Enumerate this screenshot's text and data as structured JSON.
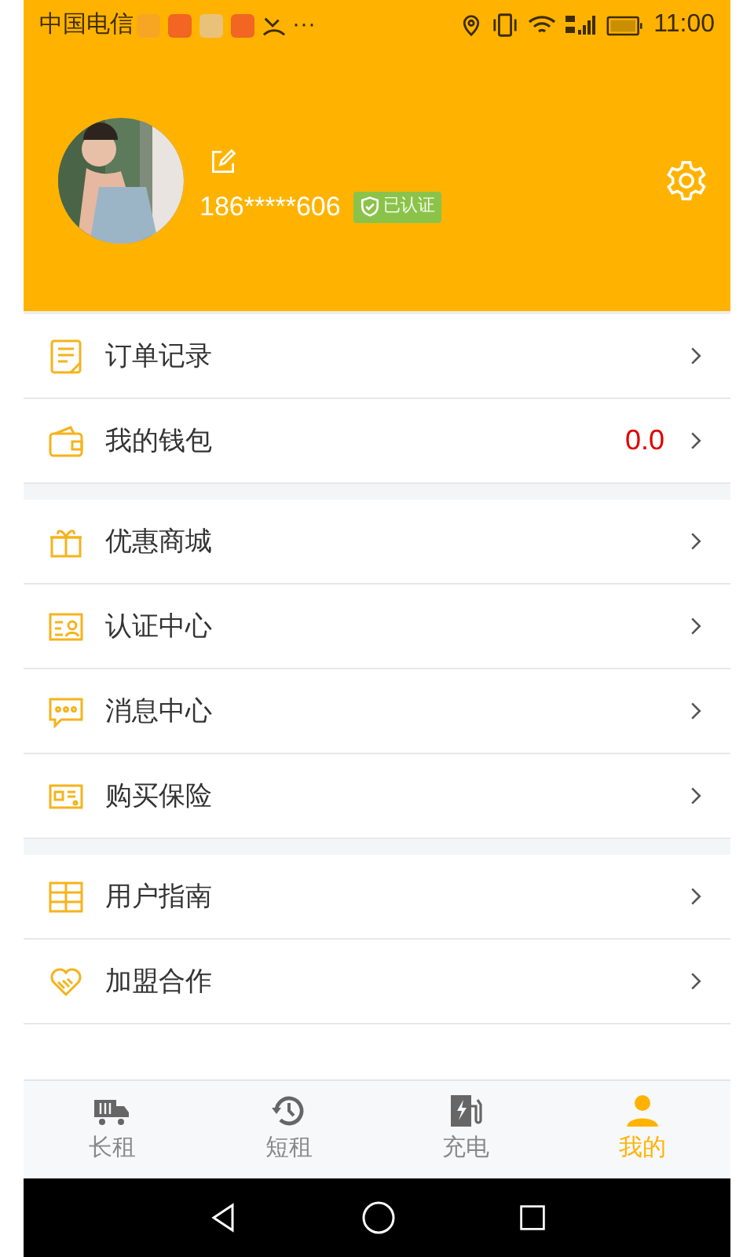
{
  "status_bar": {
    "carrier": "中国电信",
    "more": "···",
    "time": "11:00"
  },
  "profile": {
    "phone": "186*****606",
    "badge": "已认证"
  },
  "menu_groups": [
    [
      {
        "kind": "orders",
        "label": "订单记录"
      },
      {
        "kind": "wallet",
        "label": "我的钱包",
        "value": "0.0"
      }
    ],
    [
      {
        "kind": "gift",
        "label": "优惠商城"
      },
      {
        "kind": "idcard",
        "label": "认证中心"
      },
      {
        "kind": "message",
        "label": "消息中心"
      },
      {
        "kind": "ticket",
        "label": "购买保险"
      }
    ],
    [
      {
        "kind": "guide",
        "label": "用户指南"
      },
      {
        "kind": "handshake",
        "label": "加盟合作"
      }
    ]
  ],
  "tabs": [
    {
      "kind": "truck",
      "label": "长租",
      "selected": false
    },
    {
      "kind": "history",
      "label": "短租",
      "selected": false
    },
    {
      "kind": "charge",
      "label": "充电",
      "selected": false
    },
    {
      "kind": "person",
      "label": "我的",
      "selected": true
    }
  ]
}
